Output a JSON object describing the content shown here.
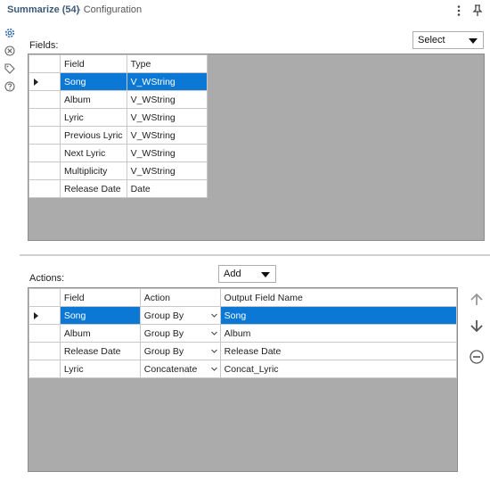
{
  "header": {
    "title": "Summarize (54)",
    "subtitle": "- Configuration",
    "more_icon": "more-vertical-icon",
    "pin_icon": "pin-icon"
  },
  "sidebar": {
    "icons": [
      "gear-icon",
      "target-icon",
      "tag-icon",
      "help-icon"
    ]
  },
  "fields": {
    "label": "Fields:",
    "select_label": "Select",
    "columns": [
      "Field",
      "Type"
    ],
    "rows": [
      {
        "field": "Song",
        "type": "V_WString",
        "selected": true
      },
      {
        "field": "Album",
        "type": "V_WString"
      },
      {
        "field": "Lyric",
        "type": "V_WString"
      },
      {
        "field": "Previous Lyric",
        "type": "V_WString"
      },
      {
        "field": "Next Lyric",
        "type": "V_WString"
      },
      {
        "field": "Multiplicity",
        "type": "V_WString"
      },
      {
        "field": "Release Date",
        "type": "Date"
      }
    ]
  },
  "actions": {
    "label": "Actions:",
    "add_label": "Add",
    "columns": [
      "Field",
      "Action",
      "Output Field Name"
    ],
    "rows": [
      {
        "field": "Song",
        "action": "Group By",
        "output": "Song",
        "selected": true
      },
      {
        "field": "Album",
        "action": "Group By",
        "output": "Album"
      },
      {
        "field": "Release Date",
        "action": "Group By",
        "output": "Release Date"
      },
      {
        "field": "Lyric",
        "action": "Concatenate",
        "output": "Concat_Lyric"
      }
    ],
    "side_buttons": [
      "arrow-up-icon",
      "arrow-down-icon",
      "remove-icon"
    ]
  },
  "colors": {
    "selection": "#0a78d4",
    "grid_background": "#ababab",
    "title": "#3b5a78"
  }
}
